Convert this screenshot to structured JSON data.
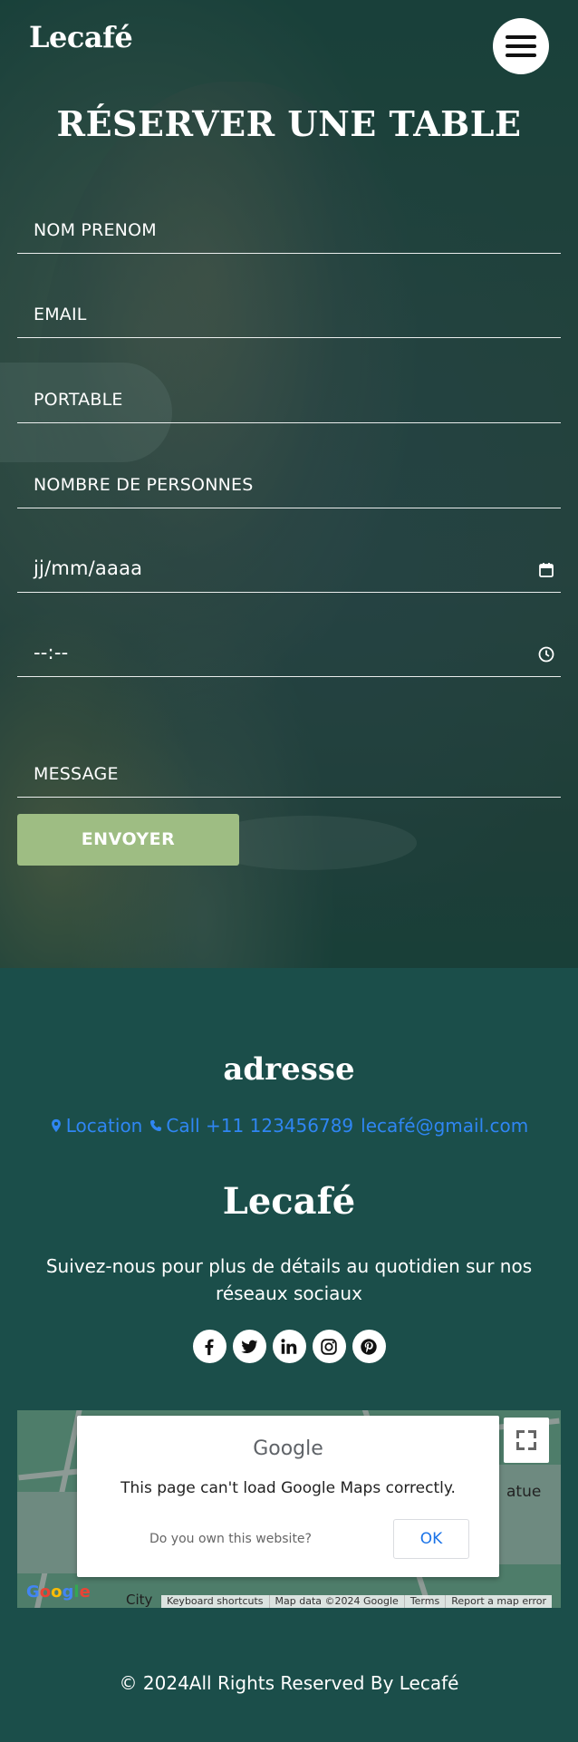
{
  "header": {
    "brand": "Lecafé",
    "menu_icon": "hamburger-menu-icon"
  },
  "booking": {
    "title": "RÉSERVER UNE TABLE",
    "fields": {
      "name_placeholder": "NOM PRENOM",
      "email_placeholder": "EMAIL",
      "phone_placeholder": "PORTABLE",
      "people_placeholder": "NOMBRE DE PERSONNES",
      "date_placeholder": "jj/mm/aaaa",
      "time_placeholder": "--:--",
      "message_placeholder": "MESSAGE"
    },
    "date_icon": "calendar-icon",
    "time_icon": "clock-icon",
    "submit_label": "ENVOYER"
  },
  "info": {
    "address_title": "adresse",
    "location_label": "Location",
    "call_label": "Call +11 123456789",
    "email_label": "lecafé@gmail.com",
    "brand": "Lecafé",
    "follow_text": "Suivez-nous pour plus de détails au quotidien sur nos réseaux sociaux",
    "socials": [
      "facebook-icon",
      "twitter-icon",
      "linkedin-icon",
      "instagram-icon",
      "pinterest-icon"
    ]
  },
  "map": {
    "dialog_brand": "Google",
    "error_message": "This page can't load Google Maps correctly.",
    "own_site_question": "Do you own this website?",
    "ok_label": "OK",
    "street_label": "atue",
    "city_label": "City",
    "logo": "Google",
    "attribution": [
      "Keyboard shortcuts",
      "Map data ©2024 Google",
      "Terms",
      "Report a map error"
    ]
  },
  "footer": {
    "copyright": "© 2024All Rights Reserved By Lecafé"
  },
  "colors": {
    "page_bg": "#1b4e4a",
    "button_green": "#9ebd83",
    "link_blue": "#2f86f3",
    "text": "#ffffff"
  }
}
